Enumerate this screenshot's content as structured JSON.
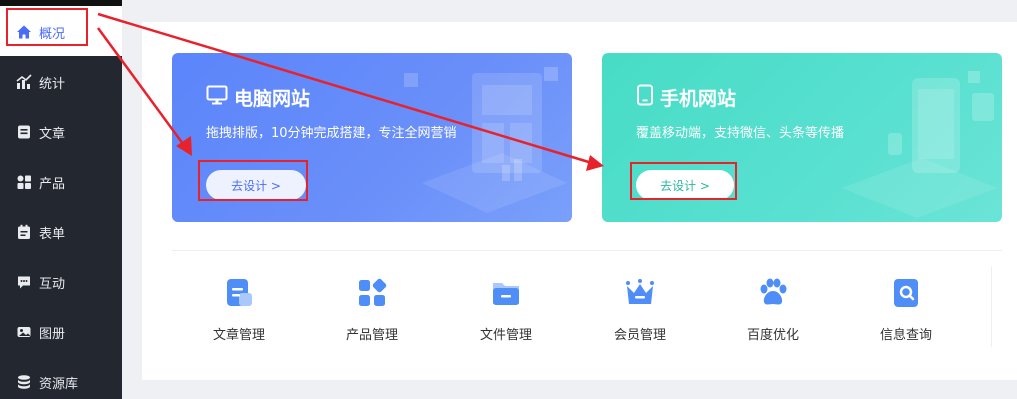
{
  "sidebar": {
    "items": [
      {
        "label": "概况",
        "icon": "home-icon",
        "active": true
      },
      {
        "label": "统计",
        "icon": "chart-icon"
      },
      {
        "label": "文章",
        "icon": "article-icon"
      },
      {
        "label": "产品",
        "icon": "grid-icon"
      },
      {
        "label": "表单",
        "icon": "form-icon"
      },
      {
        "label": "互动",
        "icon": "chat-icon"
      },
      {
        "label": "图册",
        "icon": "album-icon"
      },
      {
        "label": "资源库",
        "icon": "database-icon"
      }
    ]
  },
  "cards": {
    "pc": {
      "title": "电脑网站",
      "desc": "拖拽排版，10分钟完成搭建，专注全网营销",
      "button": "去设计 >"
    },
    "mobile": {
      "title": "手机网站",
      "desc": "覆盖移动端，支持微信、头条等传播",
      "button": "去设计 >"
    }
  },
  "tools": [
    {
      "label": "文章管理",
      "icon": "article-manage-icon"
    },
    {
      "label": "产品管理",
      "icon": "product-manage-icon"
    },
    {
      "label": "文件管理",
      "icon": "folder-icon"
    },
    {
      "label": "会员管理",
      "icon": "crown-icon"
    },
    {
      "label": "百度优化",
      "icon": "paw-icon"
    },
    {
      "label": "信息查询",
      "icon": "search-doc-icon"
    }
  ],
  "colors": {
    "accent": "#4a6cf7",
    "sidebar_bg": "#232730",
    "annotation": "#e8222a",
    "pc_card": "#5b85fb",
    "mobile_card": "#47dcc6"
  }
}
